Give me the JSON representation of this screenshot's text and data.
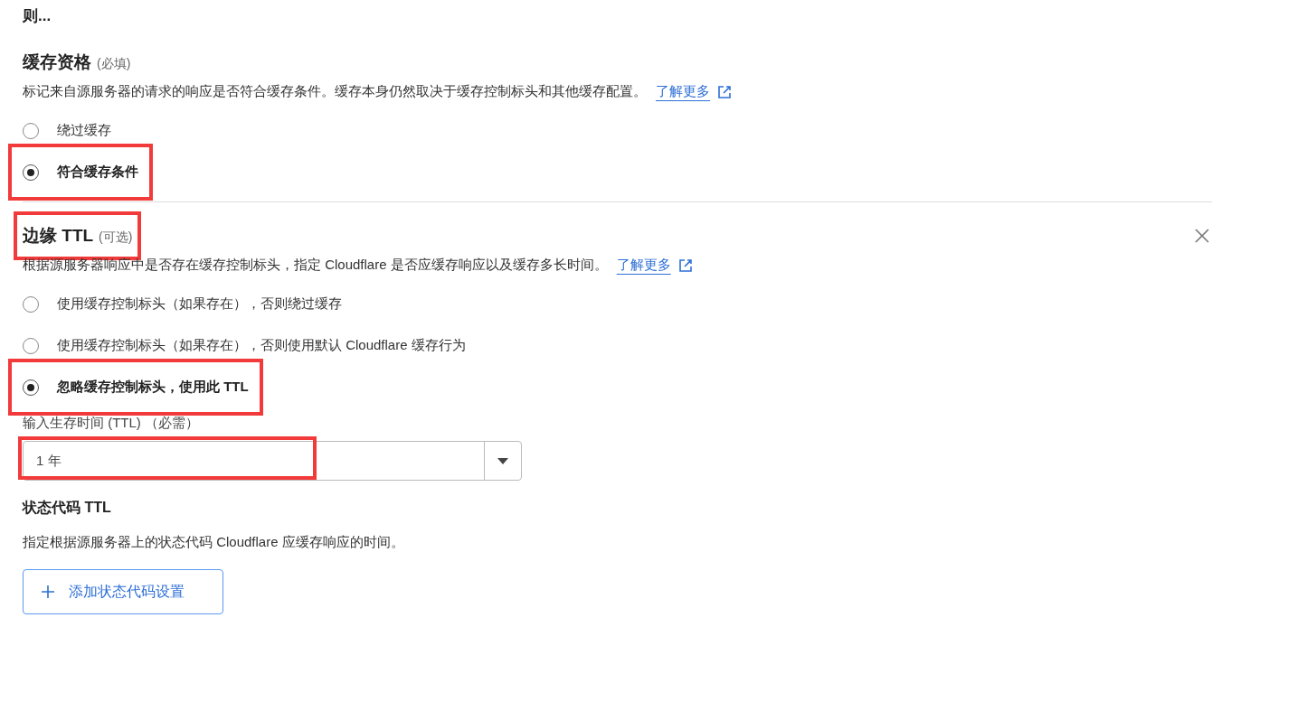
{
  "heading": "则...",
  "sections": [
    {
      "title": "缓存资格",
      "qualifier": "(必填)",
      "title_highlighted": false,
      "closable": false,
      "description": "标记来自源服务器的请求的响应是否符合缓存条件。缓存本身仍然取决于缓存控制标头和其他缓存配置。",
      "link": "了解更多",
      "options": [
        {
          "label": "绕过缓存",
          "selected": false,
          "highlighted": false
        },
        {
          "label": "符合缓存条件",
          "selected": true,
          "highlighted": true
        }
      ]
    },
    {
      "title": "边缘 TTL",
      "qualifier": "(可选)",
      "title_highlighted": true,
      "closable": true,
      "description": "根据源服务器响应中是否存在缓存控制标头，指定 Cloudflare 是否应缓存响应以及缓存多长时间。",
      "link": "了解更多",
      "options": [
        {
          "label": "使用缓存控制标头（如果存在），否则绕过缓存",
          "selected": false,
          "highlighted": false
        },
        {
          "label": "使用缓存控制标头（如果存在），否则使用默认 Cloudflare 缓存行为",
          "selected": false,
          "highlighted": false
        },
        {
          "label": "忽略缓存控制标头，使用此 TTL",
          "selected": true,
          "highlighted": true
        }
      ],
      "ttl_field": {
        "label": "输入生存时间 (TTL) （必需）",
        "value": "1 年",
        "highlighted": true
      },
      "status_ttl": {
        "title": "状态代码 TTL",
        "description": "指定根据源服务器上的状态代码 Cloudflare 应缓存响应的时间。",
        "button": "添加状态代码设置"
      }
    }
  ]
}
